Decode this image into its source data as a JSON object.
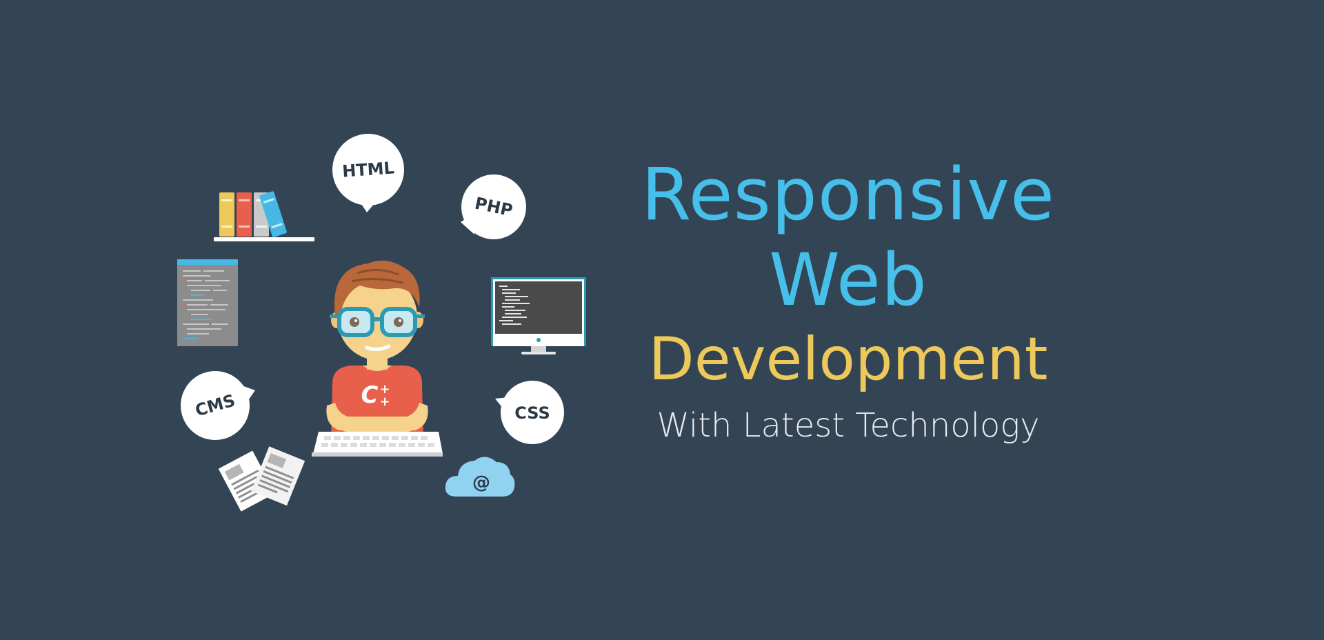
{
  "banner": {
    "headline": {
      "line1": "Responsive",
      "line2": "Web",
      "line3": "Development",
      "line4": "With Latest Technology"
    },
    "bubbles": {
      "html": "HTML",
      "php": "PHP",
      "cms": "CMS",
      "css": "CSS",
      "cloud": "@",
      "shirt_main": "C",
      "shirt_plus": "+"
    }
  },
  "colors": {
    "background": "#334455",
    "accent_blue": "#46c0ea",
    "accent_yellow": "#ecc95a",
    "subtitle": "#e8ecef"
  }
}
